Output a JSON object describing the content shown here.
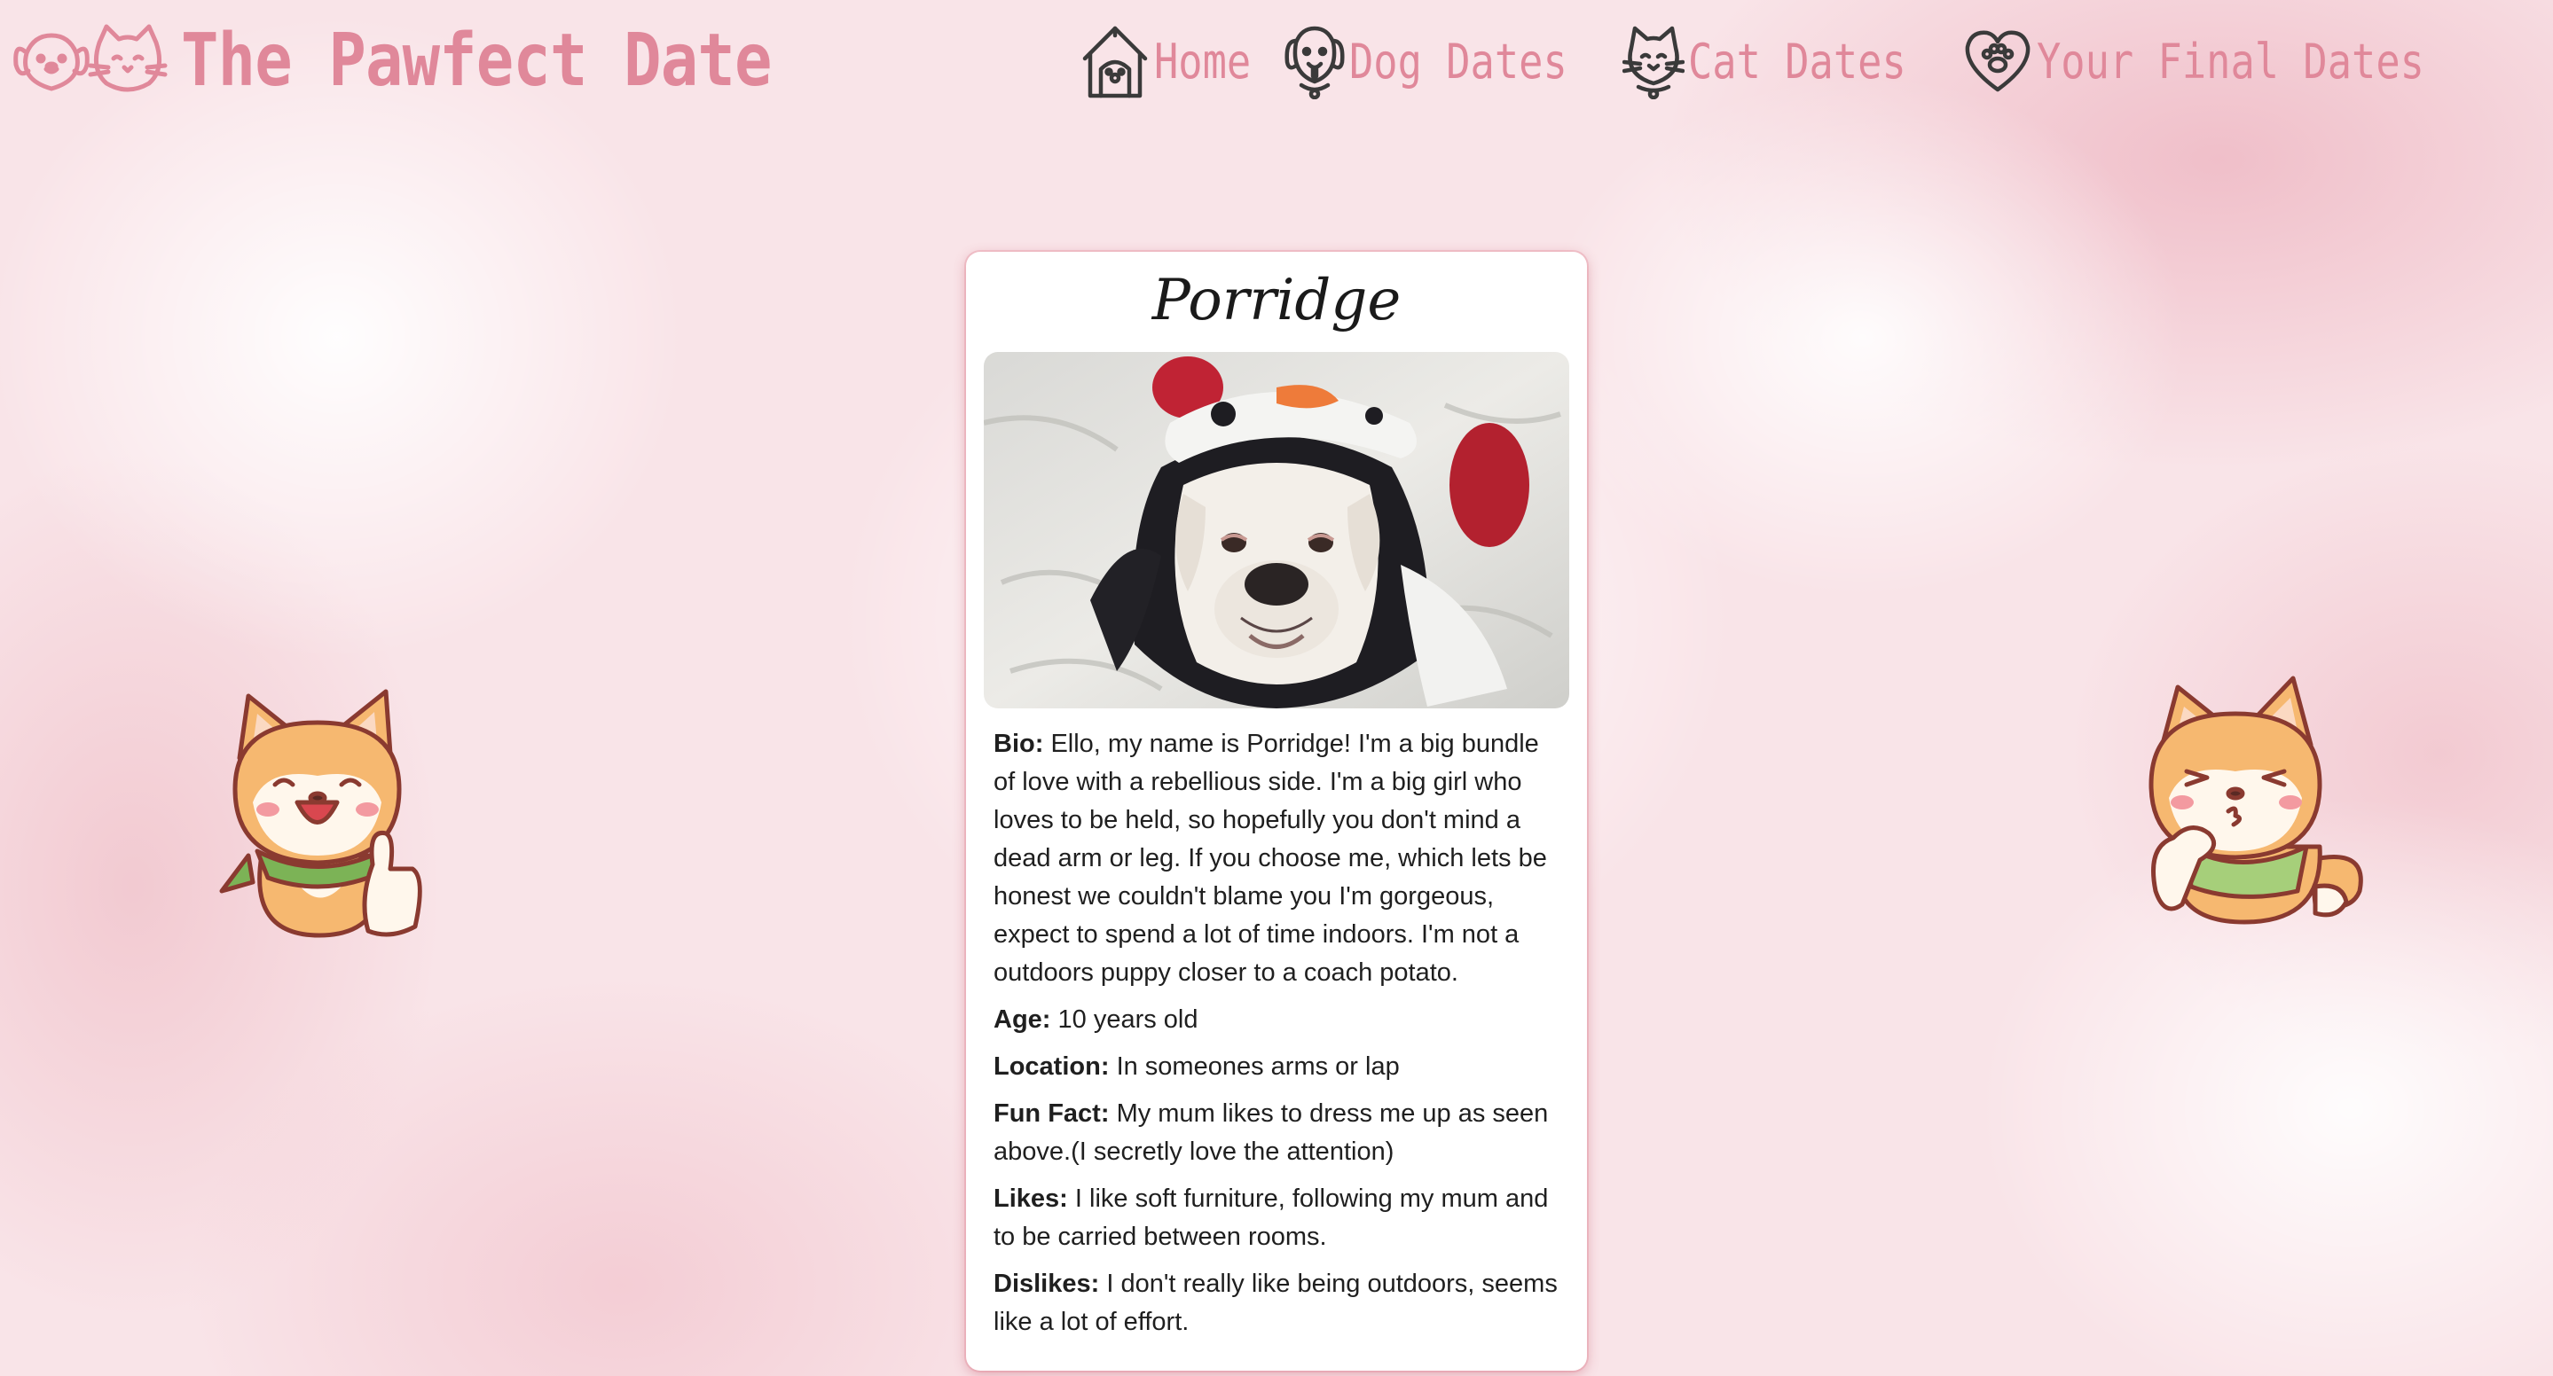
{
  "site": {
    "title": "The Pawfect Date",
    "logo_icons": [
      "dog-face-icon",
      "cat-face-icon"
    ]
  },
  "nav": {
    "items": [
      {
        "label": "Home",
        "icon": "dog-house-icon"
      },
      {
        "label": "Dog Dates",
        "icon": "dog-icon"
      },
      {
        "label": "Cat Dates",
        "icon": "cat-icon"
      },
      {
        "label": "Your Final Dates",
        "icon": "heart-paw-icon"
      }
    ]
  },
  "profile": {
    "name": "Porridge",
    "photo_icon": "dog-in-penguin-costume-photo",
    "fields": [
      {
        "label": "Bio:",
        "value": "Ello, my name is Porridge! I'm a big bundle of love with a rebellious side. I'm a big girl who loves to be held, so hopefully you don't mind a dead arm or leg. If you choose me, which lets be honest we couldn't blame you I'm gorgeous, expect to spend a lot of time indoors. I'm not a outdoors puppy closer to a coach potato."
      },
      {
        "label": "Age:",
        "value": "10 years old"
      },
      {
        "label": "Location:",
        "value": "In someones arms or lap"
      },
      {
        "label": "Fun Fact:",
        "value": "My mum likes to dress me up as seen above.(I secretly love the attention)"
      },
      {
        "label": "Likes:",
        "value": "I like soft furniture, following my mum and to be carried between rooms."
      },
      {
        "label": "Dislikes:",
        "value": "I don't really like being outdoors, seems like a lot of effort."
      }
    ]
  },
  "stickers": {
    "left": "shiba-thumbs-up-icon",
    "right": "shiba-thinking-icon"
  },
  "colors": {
    "brand": "#e0889a",
    "nav_icon": "#3a3a3a",
    "card_bg": "#ffffff",
    "page_bg": "#f9e4e8"
  }
}
